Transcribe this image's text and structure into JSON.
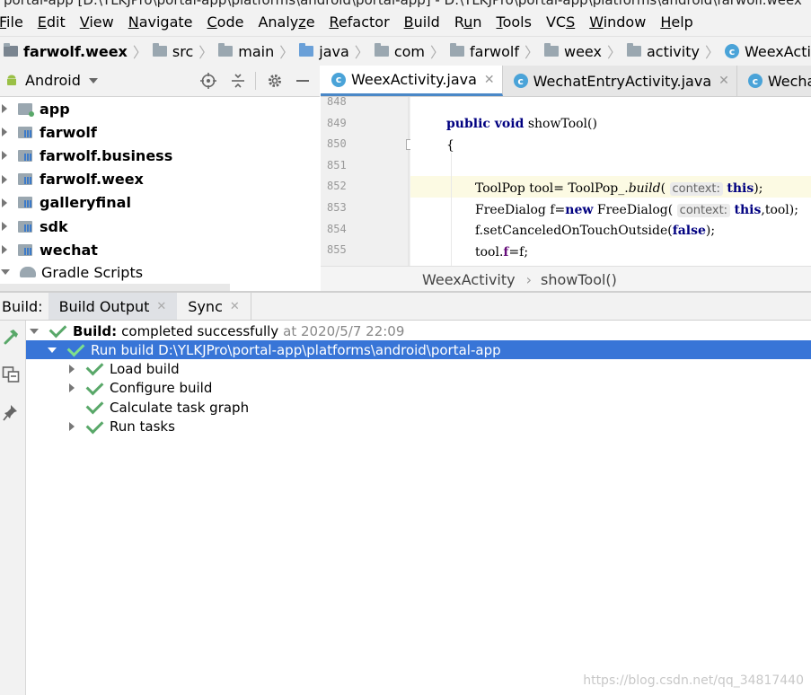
{
  "window": {
    "title": "portal-app [D:\\YLKJPro\\portal-app\\platforms\\android\\portal-app] - D:\\YLKJPro\\portal-app\\platforms\\android\\farwolf.weex"
  },
  "menu": [
    {
      "pre": "",
      "mn": "F",
      "post": "ile"
    },
    {
      "pre": "",
      "mn": "E",
      "post": "dit"
    },
    {
      "pre": "",
      "mn": "V",
      "post": "iew"
    },
    {
      "pre": "",
      "mn": "N",
      "post": "avigate"
    },
    {
      "pre": "",
      "mn": "C",
      "post": "ode"
    },
    {
      "pre": "Analy",
      "mn": "z",
      "post": "e"
    },
    {
      "pre": "",
      "mn": "R",
      "post": "efactor"
    },
    {
      "pre": "",
      "mn": "B",
      "post": "uild"
    },
    {
      "pre": "R",
      "mn": "u",
      "post": "n"
    },
    {
      "pre": "",
      "mn": "T",
      "post": "ools"
    },
    {
      "pre": "VC",
      "mn": "S",
      "post": ""
    },
    {
      "pre": "",
      "mn": "W",
      "post": "indow"
    },
    {
      "pre": "",
      "mn": "H",
      "post": "elp"
    }
  ],
  "breadcrumb": [
    "farwolf.weex",
    "src",
    "main",
    "java",
    "com",
    "farwolf",
    "weex",
    "activity",
    "WeexActivity"
  ],
  "project": {
    "view": "Android",
    "items": [
      {
        "label": "app",
        "bold": true
      },
      {
        "label": "farwolf",
        "bold": true
      },
      {
        "label": "farwolf.business",
        "bold": true
      },
      {
        "label": "farwolf.weex",
        "bold": true
      },
      {
        "label": "galleryfinal",
        "bold": true
      },
      {
        "label": "sdk",
        "bold": true
      },
      {
        "label": "wechat",
        "bold": true
      },
      {
        "label": "Gradle Scripts",
        "bold": false
      }
    ]
  },
  "editor": {
    "tabs": [
      "WeexActivity.java",
      "WechatEntryActivity.java",
      "WechatMo"
    ],
    "line_numbers": [
      "848",
      "849",
      "850",
      "851",
      "852",
      "853",
      "854",
      "855"
    ],
    "hint_label": "context:",
    "breadcrumb": [
      "WeexActivity",
      "showTool()"
    ]
  },
  "build": {
    "label": "Build:",
    "tabs": [
      "Build Output",
      "Sync"
    ],
    "root": {
      "prefix": "Build:",
      "text": "completed successfully",
      "time": "at 2020/5/7 22:09"
    },
    "run": "Run build D:\\YLKJPro\\portal-app\\platforms\\android\\portal-app",
    "tasks": [
      "Load build",
      "Configure build",
      "Calculate task graph",
      "Run tasks"
    ]
  },
  "watermark": "https://blog.csdn.net/qq_34817440",
  "colors": {
    "selection": "#3875d7",
    "accent": "#4a88c7",
    "success": "#59a869"
  }
}
